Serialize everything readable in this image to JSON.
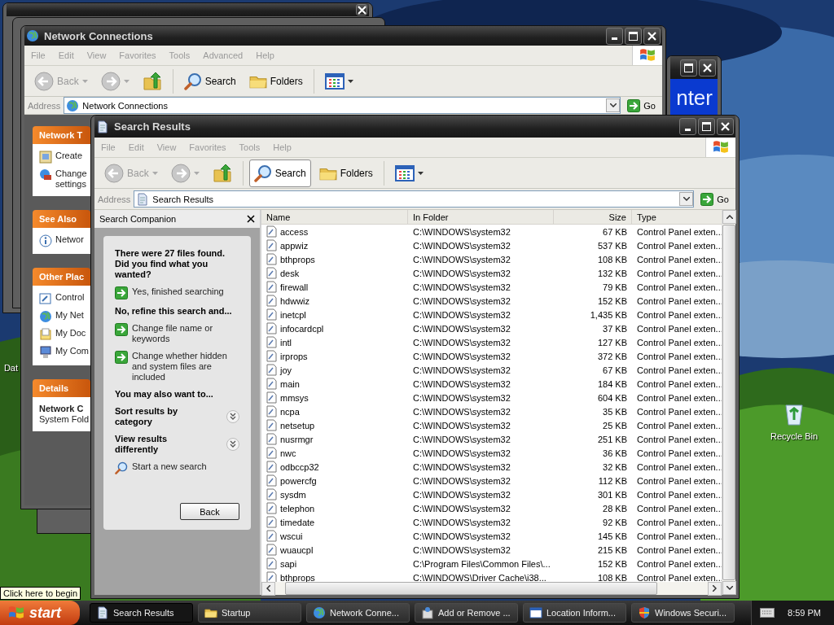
{
  "desktop": {
    "icons": [
      {
        "label": "Dat",
        "kind": "partial"
      },
      {
        "label": "Recycle Bin",
        "kind": "recycle"
      }
    ],
    "tooltip": "Click here to begin"
  },
  "security_window": {
    "banner": "nter"
  },
  "network_window": {
    "title": "Network Connections",
    "menu": [
      "File",
      "Edit",
      "View",
      "Favorites",
      "Tools",
      "Advanced",
      "Help"
    ],
    "toolbar": [
      {
        "kind": "back",
        "label": "Back",
        "selected": false
      },
      {
        "kind": "forward",
        "selected": false
      },
      {
        "kind": "up",
        "selected": false
      },
      {
        "kind": "search",
        "label": "Search",
        "selected": false
      },
      {
        "kind": "folders",
        "label": "Folders",
        "selected": false
      },
      {
        "kind": "views",
        "selected": false
      }
    ],
    "address": {
      "label": "Address",
      "value": "Network Connections",
      "go": "Go"
    },
    "task_panes": [
      {
        "title": "Network T",
        "items": [
          {
            "kind": "create",
            "label": "Create"
          },
          {
            "kind": "change",
            "label": "Change settings"
          }
        ]
      },
      {
        "title": "See Also",
        "items": [
          {
            "kind": "info",
            "label": "Networ"
          }
        ]
      },
      {
        "title": "Other Plac",
        "items": [
          {
            "kind": "control",
            "label": "Control"
          },
          {
            "kind": "network",
            "label": "My Net"
          },
          {
            "kind": "documents",
            "label": "My Doc"
          },
          {
            "kind": "computer",
            "label": "My Com"
          }
        ]
      },
      {
        "title": "Details",
        "items": [
          {
            "kind": "bold",
            "label": "Network C"
          },
          {
            "kind": "plain",
            "label": "System Fold"
          }
        ]
      }
    ]
  },
  "search_window": {
    "title": "Search Results",
    "menu": [
      "File",
      "Edit",
      "View",
      "Favorites",
      "Tools",
      "Help"
    ],
    "toolbar": [
      {
        "kind": "back",
        "label": "Back",
        "selected": false
      },
      {
        "kind": "forward",
        "selected": false
      },
      {
        "kind": "up",
        "selected": false
      },
      {
        "kind": "search",
        "label": "Search",
        "selected": true
      },
      {
        "kind": "folders",
        "label": "Folders",
        "selected": false
      },
      {
        "kind": "views",
        "selected": false
      }
    ],
    "address": {
      "label": "Address",
      "value": "Search Results",
      "go": "Go"
    },
    "companion": {
      "title": "Search Companion",
      "sections": [
        {
          "kind": "heading",
          "text": "There were 27 files found. Did you find what you wanted?"
        },
        {
          "kind": "link",
          "text": "Yes, finished searching"
        },
        {
          "kind": "heading",
          "text": "No, refine this search and..."
        },
        {
          "kind": "link",
          "text": "Change file name or keywords"
        },
        {
          "kind": "link",
          "text": "Change whether hidden and system files are included"
        },
        {
          "kind": "heading",
          "text": "You may also want to..."
        },
        {
          "kind": "expander",
          "text": "Sort results by category"
        },
        {
          "kind": "expander",
          "text": "View results differently"
        },
        {
          "kind": "search",
          "text": "Start a new search"
        }
      ],
      "back_button": "Back"
    },
    "table": {
      "columns": [
        "Name",
        "In Folder",
        "Size",
        "Type"
      ],
      "rows": [
        {
          "name": "access",
          "folder": "C:\\WINDOWS\\system32",
          "size": "67 KB",
          "type": "Control Panel exten..."
        },
        {
          "name": "appwiz",
          "folder": "C:\\WINDOWS\\system32",
          "size": "537 KB",
          "type": "Control Panel exten..."
        },
        {
          "name": "bthprops",
          "folder": "C:\\WINDOWS\\system32",
          "size": "108 KB",
          "type": "Control Panel exten..."
        },
        {
          "name": "desk",
          "folder": "C:\\WINDOWS\\system32",
          "size": "132 KB",
          "type": "Control Panel exten..."
        },
        {
          "name": "firewall",
          "folder": "C:\\WINDOWS\\system32",
          "size": "79 KB",
          "type": "Control Panel exten..."
        },
        {
          "name": "hdwwiz",
          "folder": "C:\\WINDOWS\\system32",
          "size": "152 KB",
          "type": "Control Panel exten..."
        },
        {
          "name": "inetcpl",
          "folder": "C:\\WINDOWS\\system32",
          "size": "1,435 KB",
          "type": "Control Panel exten..."
        },
        {
          "name": "infocardcpl",
          "folder": "C:\\WINDOWS\\system32",
          "size": "37 KB",
          "type": "Control Panel exten..."
        },
        {
          "name": "intl",
          "folder": "C:\\WINDOWS\\system32",
          "size": "127 KB",
          "type": "Control Panel exten..."
        },
        {
          "name": "irprops",
          "folder": "C:\\WINDOWS\\system32",
          "size": "372 KB",
          "type": "Control Panel exten..."
        },
        {
          "name": "joy",
          "folder": "C:\\WINDOWS\\system32",
          "size": "67 KB",
          "type": "Control Panel exten..."
        },
        {
          "name": "main",
          "folder": "C:\\WINDOWS\\system32",
          "size": "184 KB",
          "type": "Control Panel exten..."
        },
        {
          "name": "mmsys",
          "folder": "C:\\WINDOWS\\system32",
          "size": "604 KB",
          "type": "Control Panel exten..."
        },
        {
          "name": "ncpa",
          "folder": "C:\\WINDOWS\\system32",
          "size": "35 KB",
          "type": "Control Panel exten..."
        },
        {
          "name": "netsetup",
          "folder": "C:\\WINDOWS\\system32",
          "size": "25 KB",
          "type": "Control Panel exten..."
        },
        {
          "name": "nusrmgr",
          "folder": "C:\\WINDOWS\\system32",
          "size": "251 KB",
          "type": "Control Panel exten..."
        },
        {
          "name": "nwc",
          "folder": "C:\\WINDOWS\\system32",
          "size": "36 KB",
          "type": "Control Panel exten..."
        },
        {
          "name": "odbccp32",
          "folder": "C:\\WINDOWS\\system32",
          "size": "32 KB",
          "type": "Control Panel exten..."
        },
        {
          "name": "powercfg",
          "folder": "C:\\WINDOWS\\system32",
          "size": "112 KB",
          "type": "Control Panel exten..."
        },
        {
          "name": "sysdm",
          "folder": "C:\\WINDOWS\\system32",
          "size": "301 KB",
          "type": "Control Panel exten..."
        },
        {
          "name": "telephon",
          "folder": "C:\\WINDOWS\\system32",
          "size": "28 KB",
          "type": "Control Panel exten..."
        },
        {
          "name": "timedate",
          "folder": "C:\\WINDOWS\\system32",
          "size": "92 KB",
          "type": "Control Panel exten..."
        },
        {
          "name": "wscui",
          "folder": "C:\\WINDOWS\\system32",
          "size": "145 KB",
          "type": "Control Panel exten..."
        },
        {
          "name": "wuaucpl",
          "folder": "C:\\WINDOWS\\system32",
          "size": "215 KB",
          "type": "Control Panel exten..."
        },
        {
          "name": "sapi",
          "folder": "C:\\Program Files\\Common Files\\...",
          "size": "152 KB",
          "type": "Control Panel exten..."
        },
        {
          "name": "bthprops",
          "folder": "C:\\WINDOWS\\Driver Cache\\i38...",
          "size": "108 KB",
          "type": "Control Panel exten..."
        }
      ]
    }
  },
  "taskbar": {
    "start": "start",
    "tasks": [
      {
        "kind": "search",
        "label": "Search Results",
        "selected": true
      },
      {
        "kind": "folder",
        "label": "Startup",
        "selected": false
      },
      {
        "kind": "network",
        "label": "Network Conne...",
        "selected": false
      },
      {
        "kind": "addremove",
        "label": "Add or Remove ...",
        "selected": false
      },
      {
        "kind": "window",
        "label": "Location Inform...",
        "selected": false
      },
      {
        "kind": "shield",
        "label": "Windows Securi...",
        "selected": false
      }
    ],
    "time": "8:59 PM"
  }
}
